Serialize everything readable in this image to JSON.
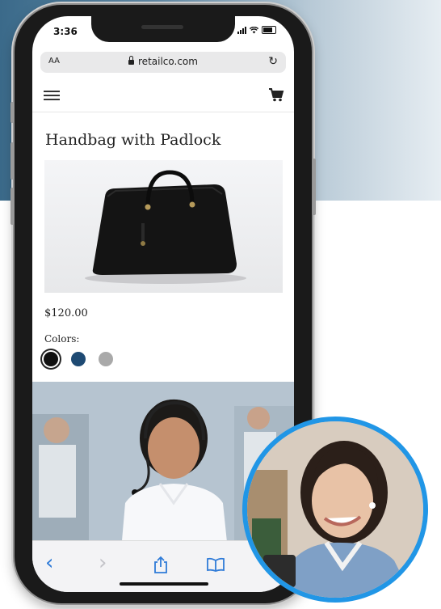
{
  "status": {
    "time": "3:36"
  },
  "browser": {
    "aa_label": "AA",
    "domain": "retailco.com",
    "reload_glyph": "↻"
  },
  "product": {
    "title": "Handbag with Padlock",
    "price": "$120.00",
    "colors_label": "Colors:",
    "colors": [
      {
        "name": "black",
        "hex": "#111111",
        "selected": true
      },
      {
        "name": "navy",
        "hex": "#1e4a73",
        "selected": false
      },
      {
        "name": "gray",
        "hex": "#a9a9a9",
        "selected": false
      }
    ]
  },
  "toolbar": {
    "back_glyph": "‹",
    "forward_glyph": "›",
    "icons": [
      "back-icon",
      "forward-icon",
      "share-icon",
      "bookmarks-icon"
    ]
  },
  "accent_color": "#2196e6"
}
